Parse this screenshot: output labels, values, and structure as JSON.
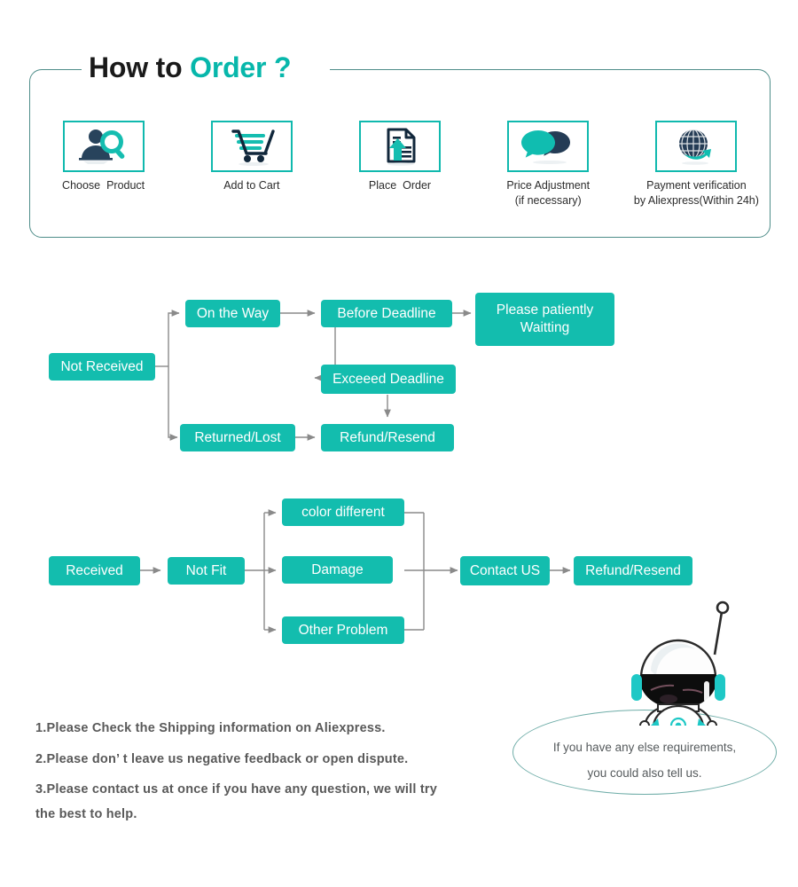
{
  "header": {
    "title_black": "How to ",
    "title_teal": "Order ?"
  },
  "colors": {
    "teal_node": "#13bdae",
    "teal_accent": "#07b7ab",
    "card_border": "#4e8d89",
    "arrow_gray": "#8a8a8a",
    "note_text": "#595959"
  },
  "steps": [
    {
      "icon": "person-search-icon",
      "label": "Choose  Product"
    },
    {
      "icon": "shopping-cart-icon",
      "label": "Add to Cart"
    },
    {
      "icon": "document-upload-icon",
      "label": "Place  Order"
    },
    {
      "icon": "chat-bubbles-icon",
      "label": "Price Adjustment\n(if necessary)"
    },
    {
      "icon": "globe-arrow-icon",
      "label": "Payment verification\nby Aliexpress(Within 24h)"
    }
  ],
  "flow_not_received": {
    "nodes": {
      "root": "Not Received",
      "on_the_way": "On the Way",
      "returned_lost": "Returned/Lost",
      "before_deadline": "Before Deadline",
      "exceed_deadline": "Exceeed Deadline",
      "please_wait": "Please patiently\nWaitting",
      "refund_resend": "Refund/Resend"
    }
  },
  "flow_received": {
    "nodes": {
      "root": "Received",
      "not_fit": "Not Fit",
      "color_different": "color different",
      "damage": "Damage",
      "other_problem": "Other Problem",
      "contact_us": "Contact US",
      "refund_resend": "Refund/Resend"
    }
  },
  "notes": [
    "1.Please Check the Shipping information on Aliexpress.",
    "2.Please don’ t leave us negative feedback or open dispute.",
    "3.Please contact us at once if you have any question, we will try",
    " the best to help."
  ],
  "bubble": {
    "line1": "If you have any else requirements,",
    "line2": "you could also tell us."
  },
  "mascot": {
    "name": "astronaut-mascot"
  }
}
